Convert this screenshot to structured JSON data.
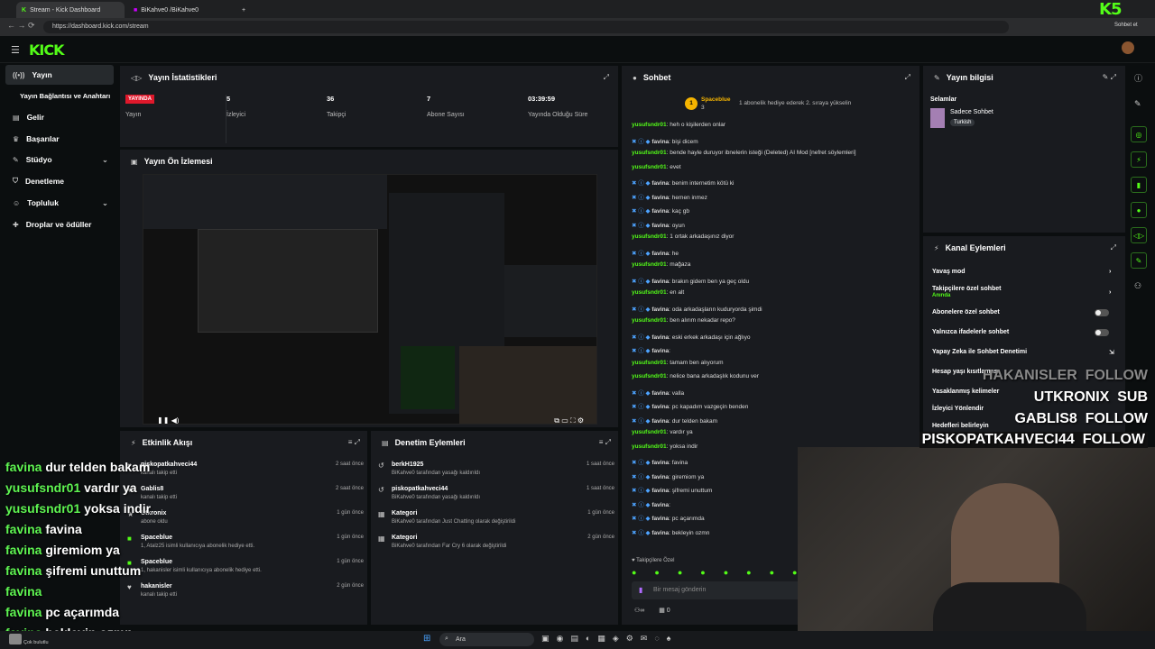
{
  "browser": {
    "tabs": [
      {
        "label": "Stream - Kick Dashboard"
      },
      {
        "label": "BiKahve0 /BiKahve0"
      }
    ],
    "url": "https://dashboard.kick.com/stream",
    "corner_logo": "K5",
    "chat_button": "Sohbet et"
  },
  "brand": {
    "logo": "KICK",
    "accent": "#53fc18"
  },
  "sidebar": {
    "items": [
      {
        "label": "Yayın",
        "icon": "broadcast-icon",
        "active": true
      },
      {
        "label": "Yayın Bağlantısı ve Anahtarı",
        "icon": ""
      },
      {
        "label": "Gelir",
        "icon": "revenue-icon"
      },
      {
        "label": "Başarılar",
        "icon": "trophy-icon"
      },
      {
        "label": "Stüdyo",
        "icon": "studio-icon"
      },
      {
        "label": "Denetleme",
        "icon": "shield-icon"
      },
      {
        "label": "Topluluk",
        "icon": "community-icon"
      },
      {
        "label": "Droplar ve ödüller",
        "icon": "gift-icon"
      }
    ]
  },
  "stats": {
    "title": "Yayın İstatistikleri",
    "live_badge": "YAYINDA",
    "live_label": "Yayın",
    "items": [
      {
        "value": "5",
        "label": "İzleyici"
      },
      {
        "value": "36",
        "label": "Takipçi"
      },
      {
        "value": "7",
        "label": "Abone Sayısı"
      },
      {
        "value": "03:39:59",
        "label": "Yayında Olduğu Süre"
      }
    ]
  },
  "preview": {
    "title": "Yayın Ön İzlemesi"
  },
  "activity": {
    "title": "Etkinlik Akışı",
    "rows": [
      {
        "name": "piskopatkahveci44",
        "sub": "kanalı takip etti",
        "time": "2 saat önce"
      },
      {
        "name": "Gablis8",
        "sub": "kanalı takip etti",
        "time": "2 saat önce"
      },
      {
        "name": "Utkronix",
        "sub": "abone oldu",
        "time": "1 gün önce"
      },
      {
        "name": "Spaceblue",
        "sub": "1, Atalz25 isimli kullanıcıya abonelik hediye etti.",
        "time": "1 gün önce"
      },
      {
        "name": "Spaceblue",
        "sub": "1, hakanisler isimli kullanıcıya abonelik hediye etti.",
        "time": "1 gün önce"
      },
      {
        "name": "hakanisler",
        "sub": "kanalı takip etti",
        "time": "2 gün önce"
      }
    ]
  },
  "moderation": {
    "title": "Denetim Eylemleri",
    "rows": [
      {
        "name": "berkH1925",
        "sub": "BiKahve0 tarafından yasağı kaldırıldı",
        "time": "1 saat önce"
      },
      {
        "name": "piskopatkahveci44",
        "sub": "BiKahve0 tarafından yasağı kaldırıldı",
        "time": "1 saat önce"
      },
      {
        "name": "Kategori",
        "sub": "BiKahve0 tarafından Just Chatting olarak değiştirildi",
        "time": "1 gün önce"
      },
      {
        "name": "Kategori",
        "sub": "BiKahve0 tarafından Far Cry 6 olarak değiştirildi",
        "time": "2 gün önce"
      }
    ]
  },
  "chat": {
    "title": "Sohbet",
    "pinned_user": "Spaceblue",
    "pinned_count": "3",
    "pinned_note": "1 abonelik hediye ederek 2. sıraya yükselin",
    "lines": [
      {
        "user": "yusufsndr01",
        "text": "heh o kişilerden onlar"
      },
      {
        "user": "favina",
        "text": "bişi dicem"
      },
      {
        "user": "yusufsndr01",
        "text": "bende hayle duruyor ibnelerin isteği (Deleted) AI Mod [nefret söylemleri]"
      },
      {
        "user": "yusufsndr01",
        "text": "evet"
      },
      {
        "user": "favina",
        "text": "benim internetim kötü ki"
      },
      {
        "user": "favina",
        "text": "hemen inmez"
      },
      {
        "user": "favina",
        "text": "kaç gb"
      },
      {
        "user": "favina",
        "text": "oyun"
      },
      {
        "user": "yusufsndr01",
        "text": "1 ortak arkadaşınız diyor"
      },
      {
        "user": "favina",
        "text": "he"
      },
      {
        "user": "yusufsndr01",
        "text": "mağaza"
      },
      {
        "user": "favina",
        "text": "brakın gidem ben ya geç oldu"
      },
      {
        "user": "yusufsndr01",
        "text": "en alt"
      },
      {
        "user": "favina",
        "text": "oda arkadaşların kuduryorda şimdi"
      },
      {
        "user": "yusufsndr01",
        "text": "ben alırım nekadar repo?"
      },
      {
        "user": "favina",
        "text": "eski erkek arkadaşı için ağlıyo"
      },
      {
        "user": "favina",
        "text": ""
      },
      {
        "user": "yusufsndr01",
        "text": "tamam ben alıyorum"
      },
      {
        "user": "yusufsndr01",
        "text": "nelice bana arkadaşlık kodunu ver"
      },
      {
        "user": "favina",
        "text": "valla"
      },
      {
        "user": "favina",
        "text": "pc kapadım vazgeçin benden"
      },
      {
        "user": "favina",
        "text": "dur telden bakam"
      },
      {
        "user": "yusufsndr01",
        "text": "vardır ya"
      },
      {
        "user": "yusufsndr01",
        "text": "yoksa indir"
      },
      {
        "user": "favina",
        "text": "favina"
      },
      {
        "user": "favina",
        "text": "giremiom ya"
      },
      {
        "user": "favina",
        "text": "şifremi unuttum"
      },
      {
        "user": "favina",
        "text": ""
      },
      {
        "user": "favina",
        "text": "pc açarımda"
      },
      {
        "user": "favina",
        "text": "bekleyin ozmn"
      }
    ],
    "followers_only": "Takipçilere Özel",
    "input_placeholder": "Bir mesaj gönderin",
    "footer_count": "0"
  },
  "stream_info": {
    "title": "Yayın bilgisi",
    "stream_title": "Selamlar",
    "category": "Sadece Sohbet",
    "tag": "Turkish"
  },
  "channel_actions": {
    "title": "Kanal Eylemleri",
    "items": [
      {
        "label": "Yavaş mod",
        "sub": "",
        "kind": "arrow"
      },
      {
        "label": "Takipçilere özel sohbet",
        "sub": "Anında",
        "kind": "arrow"
      },
      {
        "label": "Abonelere özel sohbet",
        "sub": "",
        "kind": "toggle"
      },
      {
        "label": "Yalnızca ifadelerle sohbet",
        "sub": "",
        "kind": "toggle"
      },
      {
        "label": "Yapay Zeka ile Sohbet Denetimi",
        "sub": "",
        "kind": "link"
      },
      {
        "label": "Hesap yaşı kısıtlaması",
        "sub": "",
        "kind": "arrow"
      },
      {
        "label": "Yasaklanmış kelimeler",
        "sub": "",
        "kind": "arrow"
      },
      {
        "label": "İzleyici Yönlendir",
        "sub": "",
        "kind": "arrow"
      },
      {
        "label": "Hedefleri belirleyin",
        "sub": "",
        "kind": "arrow"
      }
    ]
  },
  "overlay_chat": [
    {
      "user": "favina",
      "text": "dur telden bakam"
    },
    {
      "user": "yusufsndr01",
      "text": "vardır ya"
    },
    {
      "user": "yusufsndr01",
      "text": "yoksa indir"
    },
    {
      "user": "favina",
      "text": "favina"
    },
    {
      "user": "favina",
      "text": "giremiom ya"
    },
    {
      "user": "favina",
      "text": "şifremi unuttum"
    },
    {
      "user": "favina",
      "text": ""
    },
    {
      "user": "favina",
      "text": "pc açarımda"
    },
    {
      "user": "favina",
      "text": "bekleyin ozmn"
    }
  ],
  "overlay_alerts": [
    {
      "name": "HAKANISLER",
      "action": "FOLLOW"
    },
    {
      "name": "UTKRONIX",
      "action": "SUB"
    },
    {
      "name": "GABLIS8",
      "action": "FOLLOW"
    },
    {
      "name": "PISKOPATKAHVECI44",
      "action": "FOLLOW"
    }
  ],
  "taskbar": {
    "search": "Ara",
    "weather": "Çok bulutlu"
  }
}
